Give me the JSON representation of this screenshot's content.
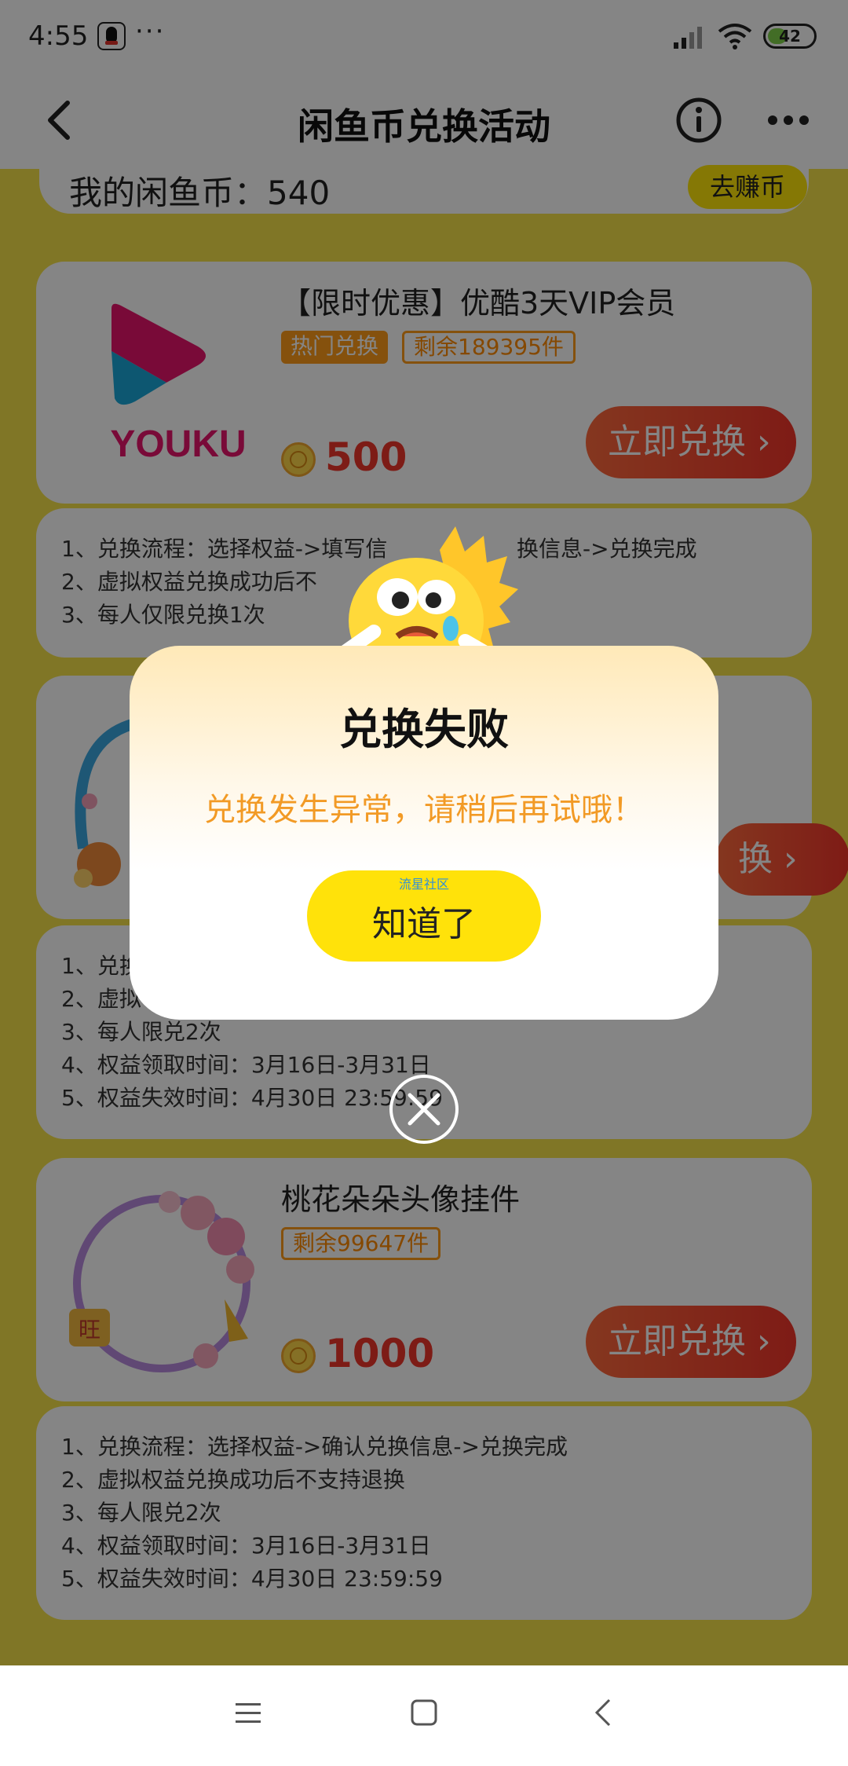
{
  "status_bar": {
    "time": "4:55",
    "dots": "···",
    "battery": "42",
    "battery_level": 0.42
  },
  "header": {
    "title": "闲鱼币兑换活动"
  },
  "coin_bar": {
    "label": "我的闲鱼币：540",
    "earn_button": "去赚币"
  },
  "items": [
    {
      "title": "【限时优惠】优酷3天VIP会员",
      "tag_hot": "热门兑换",
      "tag_stock": "剩余189395件",
      "price": "500",
      "redeem": "立即兑换",
      "logo_text": "YOUKU",
      "rules": [
        "1、兑换流程：选择权益->填写信",
        "换信息->兑换完成",
        "2、虚拟权益兑换成功后不",
        "3、每人仅限兑换1次"
      ]
    },
    {
      "redeem_partial": "换",
      "rules": [
        "1、兑换",
        "2、虚拟",
        "3、每人限兑2次",
        "4、权益领取时间：3月16日-3月31日",
        "5、权益失效时间：4月30日 23:59:59"
      ]
    },
    {
      "title": "桃花朵朵头像挂件",
      "tag_stock": "剩余99647件",
      "price": "1000",
      "redeem": "立即兑换",
      "badge": "旺",
      "rules": [
        "1、兑换流程：选择权益->确认兑换信息->兑换完成",
        "2、虚拟权益兑换成功后不支持退换",
        "3、每人限兑2次",
        "4、权益领取时间：3月16日-3月31日",
        "5、权益失效时间：4月30日 23:59:59"
      ]
    }
  ],
  "dialog": {
    "title": "兑换失败",
    "message": "兑换发生异常，请稍后再试哦！",
    "button": "知道了",
    "watermark": "流星社区"
  },
  "colors": {
    "accent_yellow": "#ffe20a",
    "price_red": "#f0372b",
    "tag_orange": "#ff9c1a"
  }
}
